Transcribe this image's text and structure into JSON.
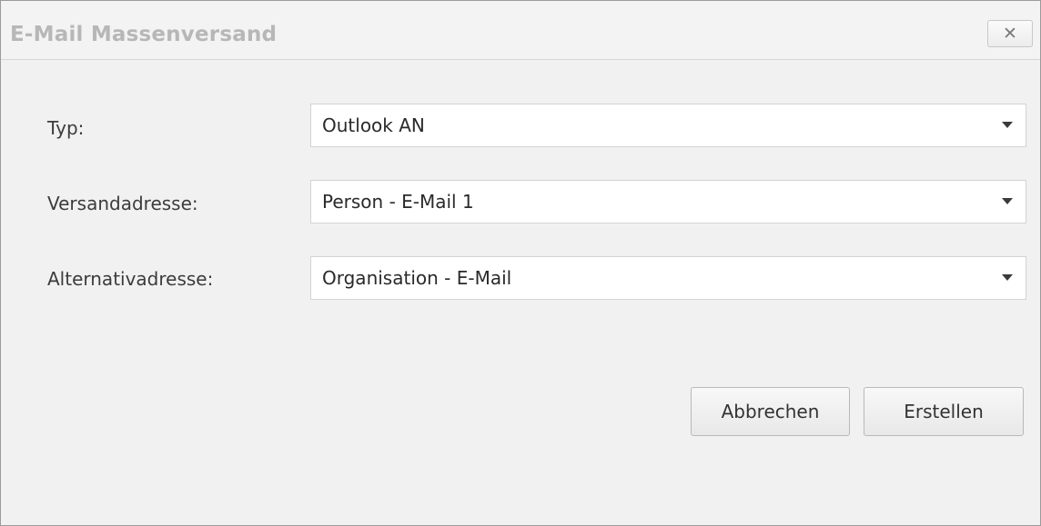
{
  "dialog": {
    "title": "E-Mail Massenversand",
    "close_glyph": "✕",
    "close_icon": "close-icon"
  },
  "form": {
    "fields": [
      {
        "label": "Typ:",
        "value": "Outlook AN"
      },
      {
        "label": "Versandadresse:",
        "value": "Person - E-Mail 1"
      },
      {
        "label": "Alternativadresse:",
        "value": "Organisation - E-Mail"
      }
    ]
  },
  "buttons": {
    "cancel_label": "Abbrechen",
    "create_label": "Erstellen"
  },
  "colors": {
    "title_text": "#b7b7b7",
    "window_bg": "#f1f1f1",
    "input_bg": "#ffffff"
  }
}
